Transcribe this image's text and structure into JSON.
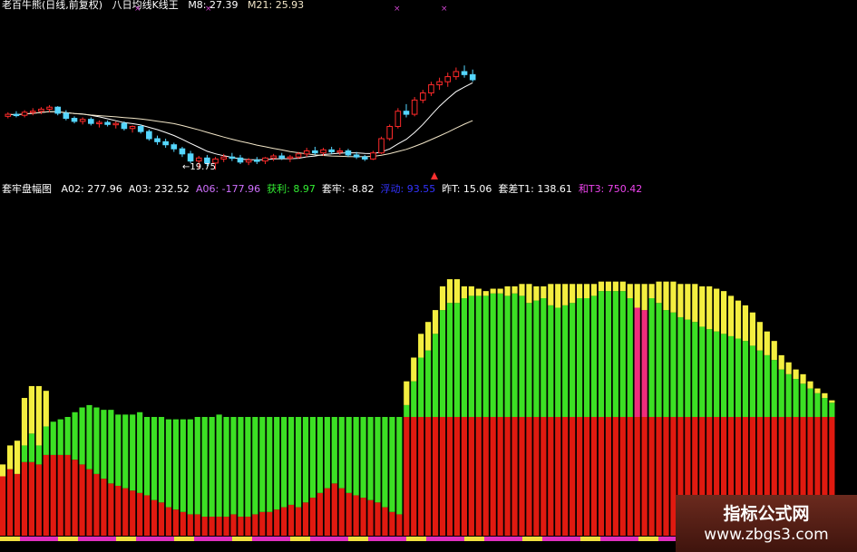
{
  "top_panel": {
    "title": "老百牛熊(日线,前复权)",
    "subtitle": "八日均线K线王",
    "m8_label": "M8: 27.39",
    "m21_label": "M21: 25.93",
    "low_price_label": "←19.75",
    "colors": {
      "up": "#ff2a2a",
      "down": "#55d6ff",
      "m8": "#ffffff",
      "m21": "#f2e6c8",
      "label": "#ffffff",
      "signal": "#cc44cc"
    }
  },
  "bottom_panel": {
    "title": "套牢盘幅图",
    "stats": [
      {
        "text": "A02: 277.96",
        "color": "#ffffff"
      },
      {
        "text": "A03: 232.52",
        "color": "#ffffff"
      },
      {
        "text": "A06: -177.96",
        "color": "#d070ff"
      },
      {
        "text": "获利: 8.97",
        "color": "#33ee33"
      },
      {
        "text": "套牢: -8.82",
        "color": "#ffffff"
      },
      {
        "text": "浮动: 93.55",
        "color": "#3333ff"
      },
      {
        "text": "昨T: 15.06",
        "color": "#ffffff"
      },
      {
        "text": "套差T1: 138.61",
        "color": "#ffffff"
      },
      {
        "text": "和T3: 750.42",
        "color": "#ee44ee"
      }
    ],
    "colors": {
      "red": "#e01a10",
      "green": "#3ce024",
      "yellow": "#f4ee40",
      "magenta": "#ee2c7c",
      "base_magenta": "#e030c0",
      "base_yellow": "#f0e040"
    }
  },
  "chart_data": {
    "type": "bar",
    "description_series": [
      "red",
      "green",
      "yellow"
    ],
    "candles": [
      [
        25.0,
        25.4,
        24.8,
        25.2
      ],
      [
        25.2,
        25.5,
        24.9,
        25.1
      ],
      [
        25.1,
        25.6,
        24.9,
        25.4
      ],
      [
        25.4,
        25.8,
        25.1,
        25.5
      ],
      [
        25.5,
        25.9,
        25.2,
        25.7
      ],
      [
        25.7,
        26.1,
        25.4,
        25.9
      ],
      [
        25.9,
        26.0,
        25.1,
        25.3
      ],
      [
        25.3,
        25.6,
        24.6,
        24.8
      ],
      [
        24.8,
        25.0,
        24.3,
        24.5
      ],
      [
        24.5,
        24.9,
        24.2,
        24.7
      ],
      [
        24.7,
        24.9,
        24.1,
        24.3
      ],
      [
        24.3,
        24.6,
        23.9,
        24.4
      ],
      [
        24.4,
        24.6,
        24.0,
        24.2
      ],
      [
        24.2,
        24.5,
        23.8,
        24.3
      ],
      [
        24.3,
        24.5,
        23.6,
        23.8
      ],
      [
        23.8,
        24.1,
        23.4,
        24.0
      ],
      [
        24.0,
        24.2,
        23.3,
        23.5
      ],
      [
        23.5,
        23.7,
        22.6,
        22.8
      ],
      [
        22.8,
        23.1,
        22.2,
        22.5
      ],
      [
        22.5,
        22.8,
        21.9,
        22.2
      ],
      [
        22.2,
        22.4,
        21.5,
        21.8
      ],
      [
        21.8,
        22.0,
        21.0,
        21.3
      ],
      [
        21.3,
        21.6,
        20.4,
        20.6
      ],
      [
        20.6,
        21.1,
        19.8,
        20.9
      ],
      [
        20.9,
        21.2,
        20.1,
        20.4
      ],
      [
        20.4,
        21.0,
        19.75,
        20.8
      ],
      [
        20.8,
        21.3,
        20.5,
        21.0
      ],
      [
        21.0,
        21.4,
        20.6,
        20.9
      ],
      [
        20.9,
        21.2,
        20.3,
        20.5
      ],
      [
        20.5,
        20.9,
        20.2,
        20.7
      ],
      [
        20.7,
        21.0,
        20.3,
        20.6
      ],
      [
        20.6,
        21.0,
        20.3,
        20.9
      ],
      [
        20.9,
        21.3,
        20.6,
        21.1
      ],
      [
        21.1,
        21.4,
        20.7,
        20.9
      ],
      [
        20.9,
        21.2,
        20.5,
        21.0
      ],
      [
        21.0,
        21.5,
        20.8,
        21.3
      ],
      [
        21.3,
        21.9,
        21.0,
        21.6
      ],
      [
        21.6,
        22.0,
        21.2,
        21.4
      ],
      [
        21.4,
        21.9,
        21.1,
        21.7
      ],
      [
        21.7,
        22.0,
        21.3,
        21.5
      ],
      [
        21.5,
        21.9,
        21.2,
        21.6
      ],
      [
        21.6,
        21.8,
        21.0,
        21.2
      ],
      [
        21.2,
        21.5,
        20.8,
        21.0
      ],
      [
        21.0,
        21.2,
        20.6,
        20.8
      ],
      [
        20.8,
        21.6,
        20.7,
        21.4
      ],
      [
        21.4,
        23.0,
        21.3,
        22.8
      ],
      [
        22.8,
        24.2,
        22.6,
        24.0
      ],
      [
        24.0,
        25.8,
        23.8,
        25.5
      ],
      [
        25.5,
        26.2,
        24.9,
        25.2
      ],
      [
        25.2,
        26.9,
        25.0,
        26.6
      ],
      [
        26.6,
        27.6,
        26.3,
        27.3
      ],
      [
        27.3,
        28.4,
        27.0,
        28.1
      ],
      [
        28.1,
        28.8,
        27.6,
        28.4
      ],
      [
        28.4,
        29.3,
        27.9,
        28.9
      ],
      [
        28.9,
        29.8,
        28.6,
        29.4
      ],
      [
        29.4,
        30.0,
        28.8,
        29.1
      ],
      [
        29.1,
        29.6,
        28.4,
        28.6
      ]
    ],
    "bars": [
      [
        25,
        0,
        5
      ],
      [
        28,
        0,
        10
      ],
      [
        26,
        0,
        14
      ],
      [
        31,
        7,
        20
      ],
      [
        31,
        12,
        20
      ],
      [
        30,
        8,
        25
      ],
      [
        34,
        12,
        15
      ],
      [
        34,
        14,
        0
      ],
      [
        34,
        15,
        0
      ],
      [
        34,
        16,
        0
      ],
      [
        32,
        20,
        0
      ],
      [
        30,
        24,
        0
      ],
      [
        28,
        27,
        0
      ],
      [
        26,
        28,
        0
      ],
      [
        24,
        29,
        0
      ],
      [
        22,
        31,
        0
      ],
      [
        21,
        30,
        0
      ],
      [
        20,
        31,
        0
      ],
      [
        19,
        32,
        0
      ],
      [
        18,
        34,
        0
      ],
      [
        17,
        33,
        0
      ],
      [
        15,
        35,
        0
      ],
      [
        14,
        36,
        0
      ],
      [
        12,
        37,
        0
      ],
      [
        11,
        38,
        0
      ],
      [
        10,
        39,
        0
      ],
      [
        9,
        40,
        0
      ],
      [
        9,
        41,
        0
      ],
      [
        8,
        42,
        0
      ],
      [
        8,
        42,
        0
      ],
      [
        8,
        43,
        0
      ],
      [
        8,
        42,
        0
      ],
      [
        9,
        41,
        0
      ],
      [
        8,
        42,
        0
      ],
      [
        8,
        42,
        0
      ],
      [
        9,
        41,
        0
      ],
      [
        10,
        40,
        0
      ],
      [
        10,
        40,
        0
      ],
      [
        11,
        39,
        0
      ],
      [
        12,
        38,
        0
      ],
      [
        13,
        37,
        0
      ],
      [
        12,
        38,
        0
      ],
      [
        14,
        36,
        0
      ],
      [
        16,
        34,
        0
      ],
      [
        18,
        32,
        0
      ],
      [
        20,
        30,
        0
      ],
      [
        22,
        28,
        0
      ],
      [
        20,
        30,
        0
      ],
      [
        18,
        32,
        0
      ],
      [
        17,
        33,
        0
      ],
      [
        16,
        34,
        0
      ],
      [
        15,
        35,
        0
      ],
      [
        14,
        36,
        0
      ],
      [
        12,
        38,
        0
      ],
      [
        10,
        40,
        0
      ],
      [
        9,
        41,
        0
      ],
      [
        50,
        5,
        10
      ],
      [
        50,
        15,
        10
      ],
      [
        50,
        25,
        10
      ],
      [
        50,
        28,
        12
      ],
      [
        50,
        35,
        10
      ],
      [
        50,
        45,
        10
      ],
      [
        50,
        48,
        10
      ],
      [
        50,
        48,
        10
      ],
      [
        50,
        50,
        5
      ],
      [
        50,
        51,
        4
      ],
      [
        50,
        51,
        3
      ],
      [
        50,
        51,
        2
      ],
      [
        50,
        52,
        2
      ],
      [
        50,
        52,
        2
      ],
      [
        50,
        51,
        4
      ],
      [
        50,
        52,
        3
      ],
      [
        50,
        51,
        5
      ],
      [
        50,
        48,
        8
      ],
      [
        50,
        49,
        6
      ],
      [
        50,
        50,
        5
      ],
      [
        50,
        47,
        9
      ],
      [
        50,
        46,
        10
      ],
      [
        50,
        47,
        9
      ],
      [
        50,
        48,
        8
      ],
      [
        50,
        50,
        6
      ],
      [
        50,
        50,
        6
      ],
      [
        50,
        51,
        5
      ],
      [
        50,
        53,
        4
      ],
      [
        50,
        53,
        4
      ],
      [
        50,
        53,
        4
      ],
      [
        50,
        53,
        4
      ],
      [
        50,
        50,
        6
      ],
      [
        50,
        46,
        10
      ],
      [
        50,
        45,
        11
      ],
      [
        50,
        50,
        6
      ],
      [
        50,
        48,
        9
      ],
      [
        50,
        45,
        12
      ],
      [
        50,
        44,
        13
      ],
      [
        50,
        42,
        14
      ],
      [
        50,
        41,
        15
      ],
      [
        50,
        40,
        16
      ],
      [
        50,
        38,
        17
      ],
      [
        50,
        37,
        18
      ],
      [
        50,
        36,
        18
      ],
      [
        50,
        35,
        18
      ],
      [
        50,
        34,
        17
      ],
      [
        50,
        33,
        16
      ],
      [
        50,
        32,
        15
      ],
      [
        50,
        30,
        14
      ],
      [
        50,
        28,
        12
      ],
      [
        50,
        26,
        10
      ],
      [
        50,
        24,
        8
      ],
      [
        50,
        20,
        6
      ],
      [
        50,
        18,
        5
      ],
      [
        50,
        16,
        4
      ],
      [
        50,
        14,
        4
      ],
      [
        50,
        12,
        3
      ],
      [
        50,
        10,
        2
      ],
      [
        50,
        8,
        2
      ],
      [
        50,
        6,
        1
      ]
    ]
  }
}
